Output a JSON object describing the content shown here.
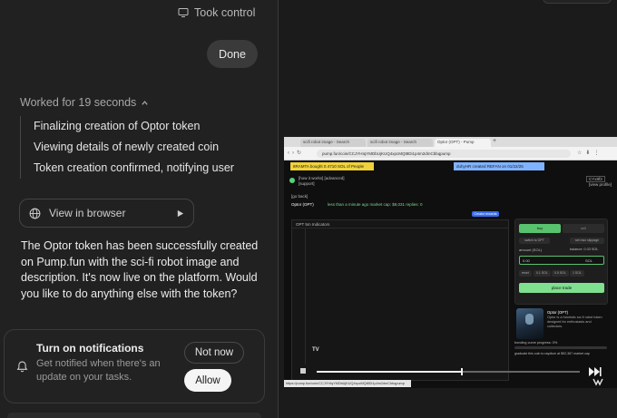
{
  "header": {
    "took_control": "Took control",
    "done_label": "Done"
  },
  "progress": {
    "worked_label": "Worked for 19 seconds",
    "steps": [
      "Finalizing creation of Optor token",
      "Viewing details of newly created coin",
      "Token creation confirmed, notifying user"
    ]
  },
  "view_browser_label": "View in browser",
  "message": "The Optor token has been successfully created on Pump.fun with the sci-fi robot image and description. It's now live on the platform. Would you like to do anything else with the token?",
  "notification": {
    "title": "Turn on notifications",
    "description": "Get notified when there's an update on your tasks.",
    "not_now": "Not now",
    "allow": "Allow"
  },
  "browser": {
    "tabs": [
      "scifi robot image - Search",
      "scifi robot image - Search",
      "Optor (OPT) - Pump"
    ],
    "url": "pump.fun/coin/CCJYHIqYMDbUjKUQ4xpcMQt8Di1p4m2dmCbbqpump",
    "ticker_yellow": "8RAMTA bought 0.4710 SOL of People",
    "ticker_blue": "duhyHR created REFAN on 01/22/25",
    "how_it_works": "[how it works] [advanced]",
    "support": "[support]",
    "connect_wallet": "CYx8f3",
    "view_profile": "[view profile]",
    "go_back": "[go back]",
    "token_line": "Optor (OPT)",
    "created_info": "less than a minute ago  market cap: $8,031  replies: 0",
    "chart_toolbar": "OPT   5m   Indicators",
    "chart_badge": "Creator rewards",
    "buy": "buy",
    "sell": "sell",
    "switch_to": "switch to OPT",
    "set_slippage": "set max slippage",
    "amount_label": "amount (SOL)",
    "balance": "balance: 0.03 SOL",
    "amount_value": "0.00",
    "amount_unit": "SOL",
    "quick": [
      "reset",
      "0.1 SOL",
      "0.5 SOL",
      "1 SOL"
    ],
    "place_trade": "place trade",
    "token_name": "Optor (OPT)",
    "token_desc": "Optor is a futuristic sci-fi robot token designed for enthusiasts and collectors.",
    "bonding": "bonding curve progress: 0%",
    "graduate": "graduate this coin to raydium at $92,367 market cap",
    "status_url": "https://pump.fun/coin/CCJYHIqYMDbUjKUQ4xpcMQt8Di1p4m2dmCbbqpump",
    "tv_logo": "TV",
    "playback_progress": 0.55
  },
  "colors": {
    "accent_green": "#58c26f",
    "ticker_yellow": "#f0d23a",
    "ticker_blue": "#7fb3ff"
  }
}
